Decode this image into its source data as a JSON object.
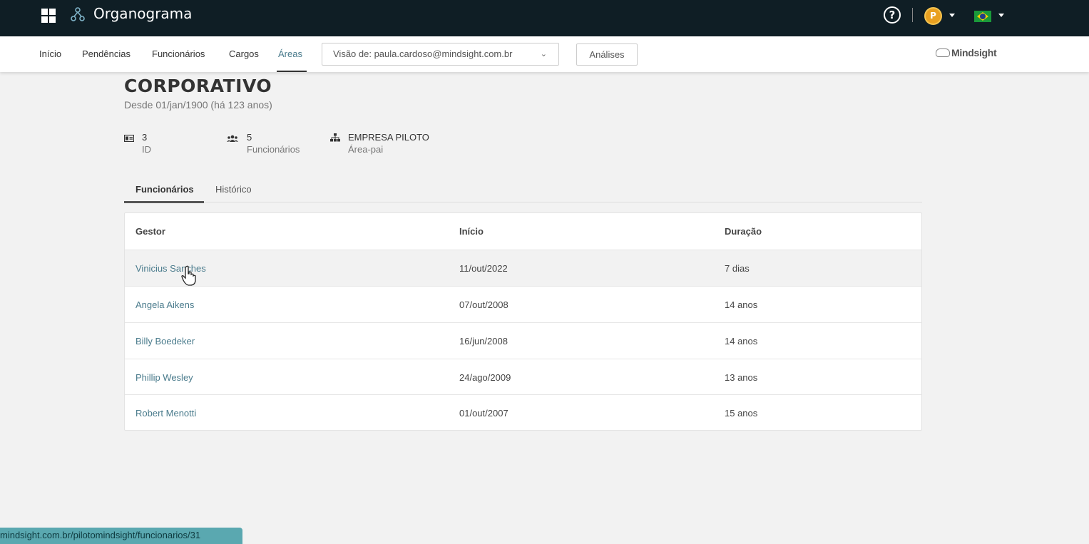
{
  "app": {
    "title": "Organograma"
  },
  "nav": {
    "items": [
      "Início",
      "Pendências",
      "Funcionários",
      "Cargos",
      "Áreas"
    ],
    "active": "Áreas",
    "view_select": "Visão de: paula.cardoso@mindsight.com.br",
    "analises": "Análises",
    "brand": "Mindsight"
  },
  "user": {
    "avatar_letter": "P"
  },
  "area": {
    "title": "CORPORATIVO",
    "subtitle": "Desde 01/jan/1900 (há 123 anos)",
    "info": [
      {
        "value": "3",
        "label": "ID",
        "icon": "id-card-icon"
      },
      {
        "value": "5",
        "label": "Funcionários",
        "icon": "users-icon"
      },
      {
        "value": "EMPRESA PILOTO",
        "label": "Área-pai",
        "icon": "hierarchy-icon"
      }
    ]
  },
  "tabs": [
    {
      "label": "Funcionários",
      "active": true
    },
    {
      "label": "Histórico",
      "active": false
    }
  ],
  "table": {
    "headers": [
      "Gestor",
      "Início",
      "Duração"
    ],
    "rows": [
      {
        "gestor": "Vinicius Sanches",
        "inicio": "11/out/2022",
        "duracao": "7 dias"
      },
      {
        "gestor": "Angela Aikens",
        "inicio": "07/out/2008",
        "duracao": "14 anos"
      },
      {
        "gestor": "Billy Boedeker",
        "inicio": "16/jun/2008",
        "duracao": "14 anos"
      },
      {
        "gestor": "Phillip Wesley",
        "inicio": "24/ago/2009",
        "duracao": "13 anos"
      },
      {
        "gestor": "Robert Menotti",
        "inicio": "01/out/2007",
        "duracao": "15 anos"
      }
    ]
  },
  "status_url": "mindsight.com.br/pilotomindsight/funcionarios/31",
  "colors": {
    "topbar": "#0f1e25",
    "accent": "#4a7b8c",
    "status_bar": "#5aa8b0"
  }
}
